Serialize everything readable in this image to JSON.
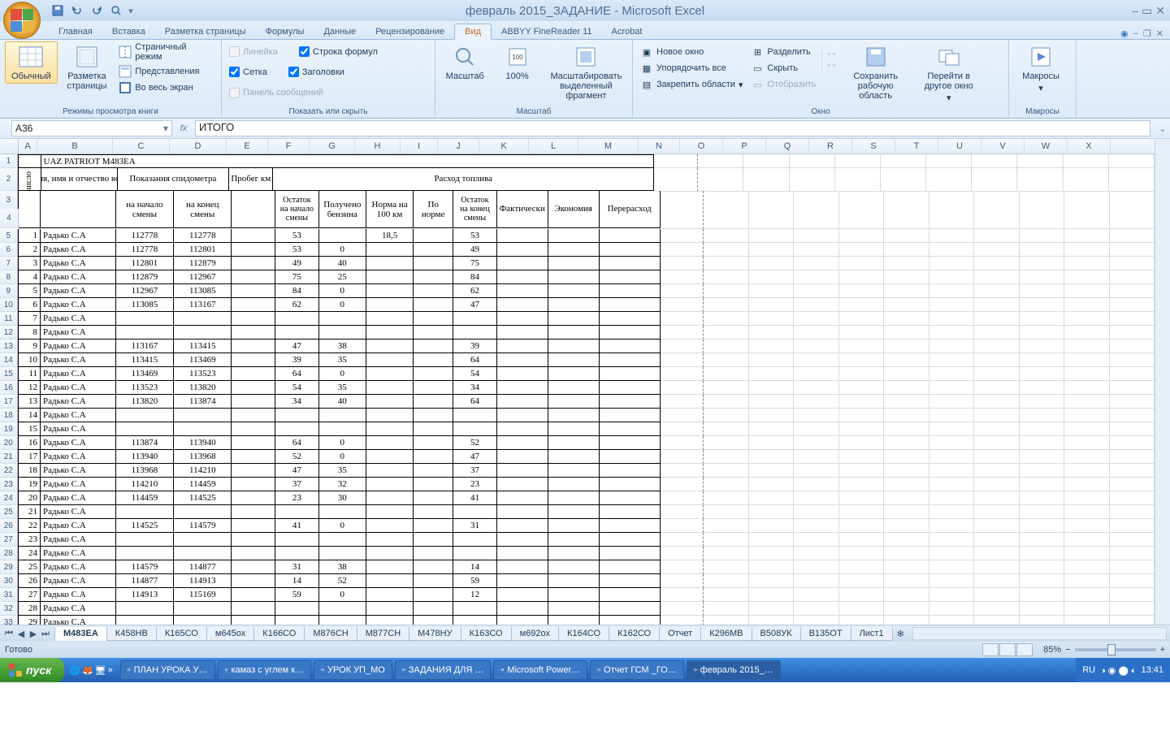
{
  "title": "февраль 2015_ЗАДАНИЕ - Microsoft Excel",
  "tabs": [
    "Главная",
    "Вставка",
    "Разметка страницы",
    "Формулы",
    "Данные",
    "Рецензирование",
    "Вид",
    "ABBYY FineReader 11",
    "Acrobat"
  ],
  "active_tab": "Вид",
  "ribbon": {
    "g1": {
      "label": "Режимы просмотра книги",
      "normal": "Обычный",
      "page_layout": "Разметка страницы",
      "page_break": "Страничный режим",
      "custom": "Представления",
      "full": "Во весь экран"
    },
    "g2": {
      "label": "Показать или скрыть",
      "ruler": "Линейка",
      "formula_bar": "Строка формул",
      "gridlines": "Сетка",
      "headings": "Заголовки",
      "msgbar": "Панель сообщений"
    },
    "g3": {
      "label": "Масштаб",
      "zoom": "Масштаб",
      "z100": "100%",
      "selection": "Масштабировать выделенный фрагмент"
    },
    "g4": {
      "label": "Окно",
      "new": "Новое окно",
      "arrange": "Упорядочить все",
      "freeze": "Закрепить области",
      "split": "Разделить",
      "hide": "Скрыть",
      "unhide": "Отобразить",
      "save_ws": "Сохранить рабочую область",
      "switch": "Перейти в другое окно"
    },
    "g5": {
      "label": "Макросы",
      "macros": "Макросы"
    }
  },
  "name_box": "A36",
  "formula": "ИТОГО",
  "columns": [
    "A",
    "B",
    "C",
    "D",
    "E",
    "F",
    "G",
    "H",
    "I",
    "J",
    "K",
    "L",
    "M",
    "N",
    "O",
    "P",
    "Q",
    "R",
    "S",
    "T",
    "U",
    "V",
    "W",
    "X"
  ],
  "sheet_title": "UAZ PATRIOT  М483ЕА",
  "headers": {
    "num": "число",
    "fio": "Фамилия, имя и отчество водителя",
    "odo": "Показания спидометра",
    "odo_start": "на начало смены",
    "odo_end": "на конец смены",
    "mileage": "Пробег км",
    "fuel": "Расход топлива",
    "rem_start": "Остаток на начало смены",
    "received": "Получено бензина",
    "norm100": "Норма на 100 км",
    "by_norm": "По норме",
    "rem_end": "Остаток на конец смены",
    "actual": "Фактически",
    "economy": "Экономия",
    "overrun": "Перерасход"
  },
  "rows": [
    {
      "n": 1,
      "d": "Радько С.А",
      "os": "112778",
      "oe": "112778",
      "rs": "53",
      "rc": "",
      "nm": "18,5",
      "re": "53"
    },
    {
      "n": 2,
      "d": "Радько С.А",
      "os": "112778",
      "oe": "112801",
      "rs": "53",
      "rc": "0",
      "nm": "",
      "re": "49"
    },
    {
      "n": 3,
      "d": "Радько С.А",
      "os": "112801",
      "oe": "112879",
      "rs": "49",
      "rc": "40",
      "nm": "",
      "re": "75"
    },
    {
      "n": 4,
      "d": "Радько С.А",
      "os": "112879",
      "oe": "112967",
      "rs": "75",
      "rc": "25",
      "nm": "",
      "re": "84"
    },
    {
      "n": 5,
      "d": "Радько С.А",
      "os": "112967",
      "oe": "113085",
      "rs": "84",
      "rc": "0",
      "nm": "",
      "re": "62"
    },
    {
      "n": 6,
      "d": "Радько С.А",
      "os": "113085",
      "oe": "113167",
      "rs": "62",
      "rc": "0",
      "nm": "",
      "re": "47"
    },
    {
      "n": 7,
      "d": "Радько С.А",
      "os": "",
      "oe": "",
      "rs": "",
      "rc": "",
      "nm": "",
      "re": ""
    },
    {
      "n": 8,
      "d": "Радько С.А",
      "os": "",
      "oe": "",
      "rs": "",
      "rc": "",
      "nm": "",
      "re": ""
    },
    {
      "n": 9,
      "d": "Радько С.А",
      "os": "113167",
      "oe": "113415",
      "rs": "47",
      "rc": "38",
      "nm": "",
      "re": "39"
    },
    {
      "n": 10,
      "d": "Радько С.А",
      "os": "113415",
      "oe": "113469",
      "rs": "39",
      "rc": "35",
      "nm": "",
      "re": "64"
    },
    {
      "n": 11,
      "d": "Радько С.А",
      "os": "113469",
      "oe": "113523",
      "rs": "64",
      "rc": "0",
      "nm": "",
      "re": "54"
    },
    {
      "n": 12,
      "d": "Радько С.А",
      "os": "113523",
      "oe": "113820",
      "rs": "54",
      "rc": "35",
      "nm": "",
      "re": "34"
    },
    {
      "n": 13,
      "d": "Радько С.А",
      "os": "113820",
      "oe": "113874",
      "rs": "34",
      "rc": "40",
      "nm": "",
      "re": "64"
    },
    {
      "n": 14,
      "d": "Радько С.А",
      "os": "",
      "oe": "",
      "rs": "",
      "rc": "",
      "nm": "",
      "re": ""
    },
    {
      "n": 15,
      "d": "Радько С.А",
      "os": "",
      "oe": "",
      "rs": "",
      "rc": "",
      "nm": "",
      "re": ""
    },
    {
      "n": 16,
      "d": "Радько С.А",
      "os": "113874",
      "oe": "113940",
      "rs": "64",
      "rc": "0",
      "nm": "",
      "re": "52"
    },
    {
      "n": 17,
      "d": "Радько С.А",
      "os": "113940",
      "oe": "113968",
      "rs": "52",
      "rc": "0",
      "nm": "",
      "re": "47"
    },
    {
      "n": 18,
      "d": "Радько С.А",
      "os": "113968",
      "oe": "114210",
      "rs": "47",
      "rc": "35",
      "nm": "",
      "re": "37"
    },
    {
      "n": 19,
      "d": "Радько С.А",
      "os": "114210",
      "oe": "114459",
      "rs": "37",
      "rc": "32",
      "nm": "",
      "re": "23"
    },
    {
      "n": 20,
      "d": "Радько С.А",
      "os": "114459",
      "oe": "114525",
      "rs": "23",
      "rc": "30",
      "nm": "",
      "re": "41"
    },
    {
      "n": 21,
      "d": "Радько С.А",
      "os": "",
      "oe": "",
      "rs": "",
      "rc": "",
      "nm": "",
      "re": ""
    },
    {
      "n": 22,
      "d": "Радько С.А",
      "os": "114525",
      "oe": "114579",
      "rs": "41",
      "rc": "0",
      "nm": "",
      "re": "31"
    },
    {
      "n": 23,
      "d": "Радько С.А",
      "os": "",
      "oe": "",
      "rs": "",
      "rc": "",
      "nm": "",
      "re": ""
    },
    {
      "n": 24,
      "d": "Радько С.А",
      "os": "",
      "oe": "",
      "rs": "",
      "rc": "",
      "nm": "",
      "re": ""
    },
    {
      "n": 25,
      "d": "Радько С.А",
      "os": "114579",
      "oe": "114877",
      "rs": "31",
      "rc": "38",
      "nm": "",
      "re": "14"
    },
    {
      "n": 26,
      "d": "Радько С.А",
      "os": "114877",
      "oe": "114913",
      "rs": "14",
      "rc": "52",
      "nm": "",
      "re": "59"
    },
    {
      "n": 27,
      "d": "Радько С.А",
      "os": "114913",
      "oe": "115169",
      "rs": "59",
      "rc": "0",
      "nm": "",
      "re": "12"
    },
    {
      "n": 28,
      "d": "Радько С.А",
      "os": "",
      "oe": "",
      "rs": "",
      "rc": "",
      "nm": "",
      "re": ""
    },
    {
      "n": 29,
      "d": "Радько С.А",
      "os": "",
      "oe": "",
      "rs": "",
      "rc": "",
      "nm": "",
      "re": ""
    }
  ],
  "sheet_tabs": [
    "М483ЕА",
    "К458НВ",
    "К165СО",
    "м645ох",
    "К166СО",
    "М876СН",
    "М877СН",
    "М478НУ",
    "К163СО",
    "м692ох",
    "К164СО",
    "К162СО",
    "Отчет",
    "К296МВ",
    "В508УК",
    "В135ОТ",
    "Лист1"
  ],
  "active_sheet": "М483ЕА",
  "status": "Готово",
  "zoom": "85%",
  "taskbar": {
    "start": "пуск",
    "items": [
      "ПЛАН УРОКА У…",
      "камаз с углем к…",
      "УРОК УП_МО",
      "ЗАДАНИЯ ДЛЯ …",
      "Microsoft Power…",
      "Отчет ГСМ _ГО…",
      "февраль 2015_…"
    ],
    "lang": "RU",
    "time": "13:41"
  }
}
